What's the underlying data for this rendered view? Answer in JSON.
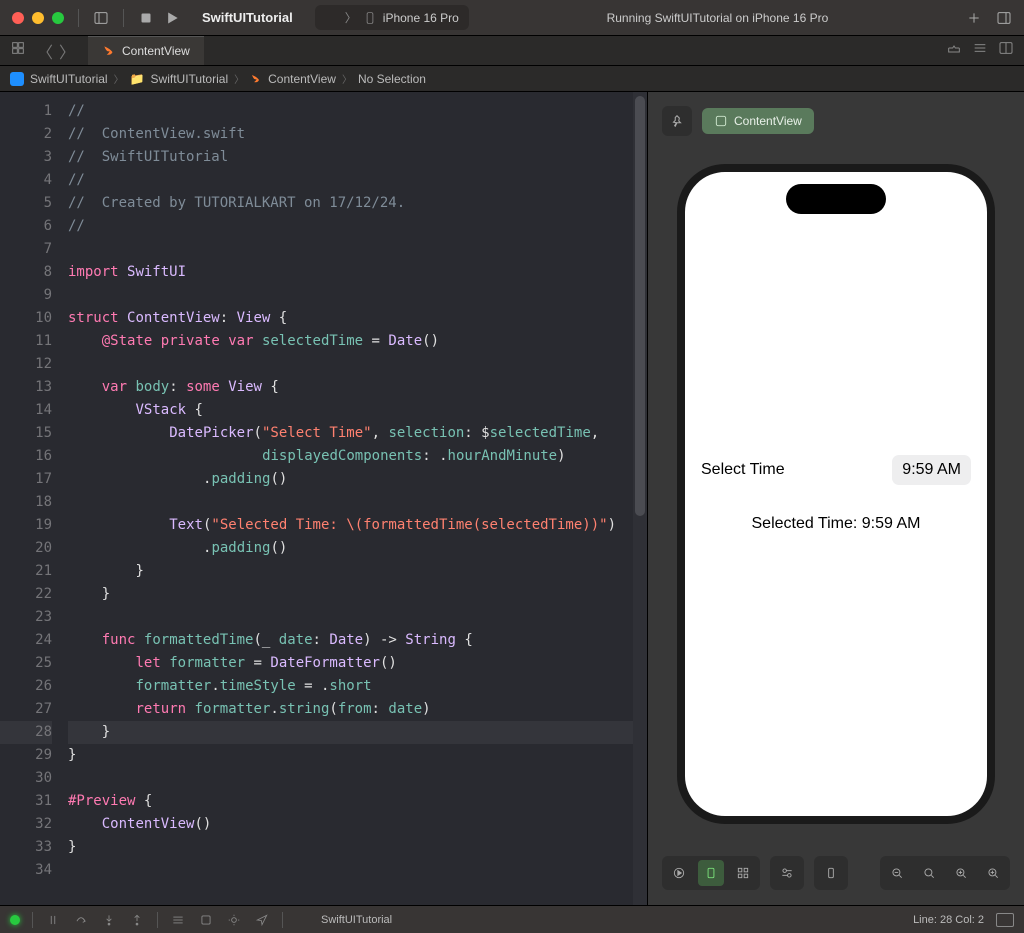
{
  "titlebar": {
    "project_name": "SwiftUITutorial",
    "device": "iPhone 16 Pro",
    "status": "Running SwiftUITutorial on iPhone 16 Pro"
  },
  "tab": {
    "filename": "ContentView"
  },
  "breadcrumb": {
    "items": [
      "SwiftUITutorial",
      "SwiftUITutorial",
      "ContentView",
      "No Selection"
    ]
  },
  "editor": {
    "current_line_highlight": 28,
    "lines": [
      "//",
      "//  ContentView.swift",
      "//  SwiftUITutorial",
      "//",
      "//  Created by TUTORIALKART on 17/12/24.",
      "//",
      "",
      "import SwiftUI",
      "",
      "struct ContentView: View {",
      "    @State private var selectedTime = Date()",
      "",
      "    var body: some View {",
      "        VStack {",
      "            DatePicker(\"Select Time\", selection: $selectedTime,",
      "                       displayedComponents: .hourAndMinute)",
      "                .padding()",
      "",
      "            Text(\"Selected Time: \\(formattedTime(selectedTime))\")",
      "                .padding()",
      "        }",
      "    }",
      "",
      "    func formattedTime(_ date: Date) -> String {",
      "        let formatter = DateFormatter()",
      "        formatter.timeStyle = .short",
      "        return formatter.string(from: date)",
      "    }",
      "}",
      "",
      "#Preview {",
      "    ContentView()",
      "}",
      ""
    ]
  },
  "preview": {
    "badge": "ContentView",
    "app": {
      "datepicker_label": "Select Time",
      "datepicker_value": "9:59 AM",
      "selected_text": "Selected Time: 9:59 AM"
    }
  },
  "statusbar": {
    "project": "SwiftUITutorial",
    "cursor": "Line: 28  Col: 2"
  }
}
